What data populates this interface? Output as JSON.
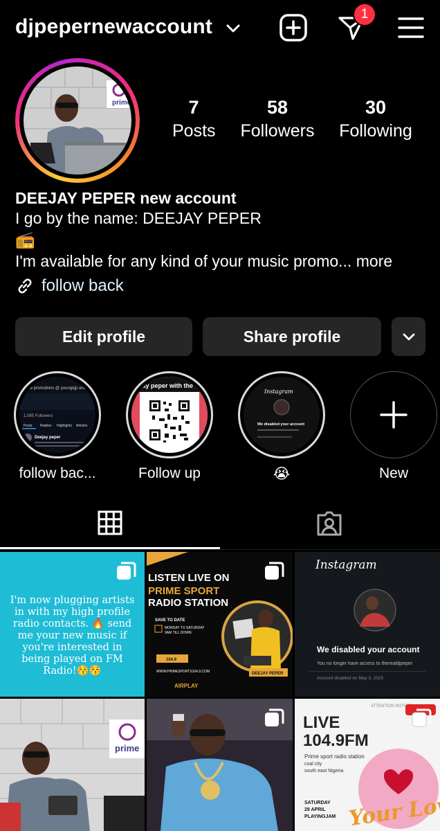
{
  "header": {
    "username": "djpepernewaccount",
    "badge_count": "1",
    "icons": [
      "chevron-down-icon",
      "create-post-icon",
      "direct-message-icon",
      "menu-icon"
    ]
  },
  "profile": {
    "stats": [
      {
        "num": "7",
        "label": "Posts"
      },
      {
        "num": "58",
        "label": "Followers"
      },
      {
        "num": "30",
        "label": "Following"
      }
    ],
    "display_name": "DEEJAY PEPER new account",
    "bio_line1": "I go by the name: DEEJAY PEPER",
    "bio_emoji": "📻",
    "bio_line2": "I'm available for any kind of your music promo...",
    "more_label": "more",
    "link_text": "follow back"
  },
  "buttons": {
    "edit": "Edit profile",
    "share": "Share profile"
  },
  "highlights": [
    {
      "label": "follow bac..."
    },
    {
      "label": "Follow up"
    },
    {
      "label": "😭"
    },
    {
      "label": "New"
    }
  ],
  "posts": {
    "p1_text": "I'm now plugging artists in with my high profile radio contacts. 🔥 send me your new music if you're interested in being played on FM Radio!😚😚",
    "p2_title1": "LISTEN LIVE ON",
    "p2_title2": "PRIME SPORT",
    "p2_title3": "RADIO STATION",
    "p2_save": "SAVE TO DATE",
    "p2_days": "MONDAY TO SATURDAY",
    "p2_time": "9AM TILL DOWN",
    "p2_freq": "104.9",
    "p2_dj": "DEEJAY PEPER",
    "p2_url": "WWW.PRIMESPORTS104.9.COM",
    "p2_airplay": "AIRPLAY",
    "p3_brand": "Instagram",
    "p3_title": "We disabled your account",
    "p3_sub": "You no longer have access to therealdjpeper",
    "p3_date": "Account disabled on May 3, 2025",
    "p4_brand": "prime",
    "p6_notice": "ATTENTION NOTICE",
    "p6_live": "LIVE",
    "p6_freq": "104.9FM",
    "p6_station": "Prime sport radio station",
    "p6_city": "coal city",
    "p6_region": "south east Nigeria",
    "p6_date1": "SATURDAY",
    "p6_date2": "29 APRIL",
    "p6_date3": "PLAYINGJAM",
    "p6_script": "Your Love"
  },
  "highlight_thumbs": {
    "h1_top": "new promotions @ youngdjp and",
    "h1_name": "Deejay peper",
    "h1_tabs": [
      "Posts",
      "Replies",
      "Highlights",
      "Articles"
    ],
    "h1_followers": "1,085 Followers",
    "h2_top": "...ay peper with the",
    "h3_brand": "Instagram",
    "h3_title": "We disabled your account"
  },
  "colors": {
    "accent_badge": "#ff3040",
    "button_bg": "#262626",
    "post1_bg": "#1fbcd6"
  }
}
